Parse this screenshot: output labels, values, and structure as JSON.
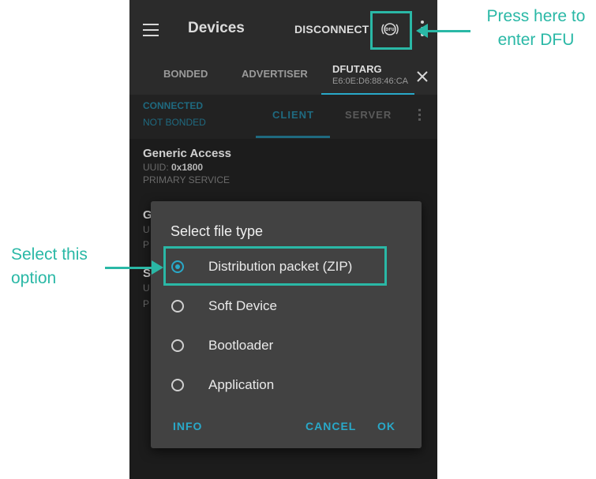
{
  "appbar": {
    "title": "Devices",
    "disconnect": "DISCONNECT"
  },
  "tabs": {
    "bonded": "BONDED",
    "advertiser": "ADVERTISER",
    "dfu_name": "DFUTARG",
    "dfu_addr": "E6:0E:D6:88:46:CA"
  },
  "subbar": {
    "status1": "CONNECTED",
    "status2": "NOT BONDED",
    "client": "CLIENT",
    "server": "SERVER"
  },
  "services": [
    {
      "name": "Generic Access",
      "uuid_label": "UUID: ",
      "uuid_value": "0x1800",
      "type": "PRIMARY SERVICE"
    }
  ],
  "partial": {
    "g": "G",
    "u1": "U",
    "p1": "P",
    "s": "S",
    "u2": "U",
    "p2": "P"
  },
  "dialog": {
    "title": "Select file type",
    "options": [
      "Distribution packet (ZIP)",
      "Soft Device",
      "Bootloader",
      "Application"
    ],
    "selected_index": 0,
    "info": "INFO",
    "cancel": "CANCEL",
    "ok": "OK"
  },
  "annotations": {
    "dfu_line1": "Press here to",
    "dfu_line2": "enter DFU",
    "option_line1": "Select this",
    "option_line2": "option"
  },
  "colors": {
    "accent": "#29a9c9",
    "annotation": "#2ab8a6"
  }
}
